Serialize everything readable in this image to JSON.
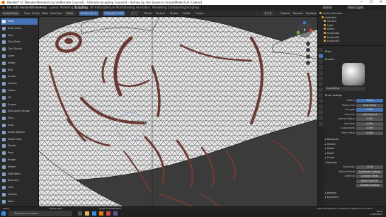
{
  "titlebar": {
    "title": "Blender* [C:\\Blender\\Remote\\Course\\Remote Course2\\ - Ultimate Sculpting Course\\3 - Setting Up Our Scene to Sculpt\\Model Full 2.blend]",
    "minimize": "—",
    "maximize": "☐",
    "close": "✕"
  },
  "menubar": {
    "items": [
      "File",
      "Edit",
      "Render",
      "Window",
      "Help"
    ],
    "workspaces": [
      "Layout",
      "Modeling",
      "Sculpting",
      "UV Editing",
      "Texture Paint",
      "Shading",
      "Animation",
      "Rendering",
      "Compositing",
      "Scripting"
    ],
    "active_workspace": "Sculpting",
    "scene": "Scene",
    "view_layer": "View Layer"
  },
  "toolheader": {
    "mode": "Sculpt Mode",
    "menus": [
      "View",
      "Sculpt",
      "Mask",
      "Face Sets"
    ],
    "brush": "Draw",
    "radius": "Radius 50 px",
    "strength": "Strength 0.500",
    "direction": "+  −",
    "options": [
      "Brush",
      "Texture",
      "Stroke",
      "Falloff",
      "Cursor"
    ],
    "symmetry": "X  Y  Z",
    "extras": [
      "Options",
      "Remesh",
      "Dyntopo"
    ]
  },
  "tools": [
    "Draw",
    "Draw Sharp",
    "Clay",
    "Clay Strips",
    "Clay Thumb",
    "Layer",
    "Inflate",
    "Blob",
    "Crease",
    "Smooth",
    "Flatten",
    "Fill",
    "Scrape",
    "Multi-plane Scrape",
    "Pinch",
    "Grab",
    "Elastic Deform",
    "Snake Hook",
    "Thumb",
    "Pose",
    "Nudge",
    "Rotate",
    "Slide Relax",
    "Boundary",
    "Cloth",
    "Simplify",
    "Mask"
  ],
  "active_tool": "Draw",
  "outliner": {
    "rows": [
      "Scene Collection",
      "Collection",
      "Camera",
      "Light",
      "Empty",
      "Empty.001",
      "Empty.002",
      "Empty.003"
    ]
  },
  "properties": {
    "header": "Draw",
    "brush_name": "SculptDraw",
    "section_brush": "Brushes",
    "section_settings": "Brush Settings",
    "rows": [
      {
        "label": "Radius",
        "value": "50 px"
      },
      {
        "label": "Radius Unit",
        "value": "View     Scene"
      },
      {
        "label": "Strength",
        "value": "0.500"
      },
      {
        "label": "Direction",
        "value": "Add      Subtract"
      },
      {
        "label": "Normal Radius",
        "value": "0.500"
      },
      {
        "label": "Hardness",
        "value": "0.000"
      },
      {
        "label": "Autosmooth",
        "value": "0.000"
      },
      {
        "label": "Plane Offset",
        "value": "0.000"
      }
    ],
    "collapsed_sections": [
      "Advanced",
      "Texture",
      "Stroke",
      "Falloff",
      "Cursor",
      "Dyntopo"
    ],
    "dyntopo": [
      {
        "label": "Resolution",
        "value": "12.00"
      },
      {
        "label": "Refine Method",
        "value": "Subdivide Collapse"
      },
      {
        "label": "Detailing",
        "value": "Constant Detail"
      }
    ],
    "detail_flood": "Detail Flood Fill",
    "smooth_shading": "Smooth Shading",
    "bottom_sections": [
      "Remesh",
      "Symmetry"
    ]
  },
  "statusbar": {
    "left": [
      "Select",
      "Rotate View",
      "Sculpt Context Menu"
    ],
    "right": "Fish | Verts:8,507 | Tris:16,270 | Objects:1/1 | 2.93.1"
  },
  "taskbar": {
    "search_placeholder": "Type here to search",
    "time": "10:24",
    "date": "11/07/2021"
  },
  "colors": {
    "accent": "#4772b3",
    "brush_stroke": "#6b3a34",
    "mesh_fill": "#e9e9e9",
    "background": "#3b3b3b"
  }
}
